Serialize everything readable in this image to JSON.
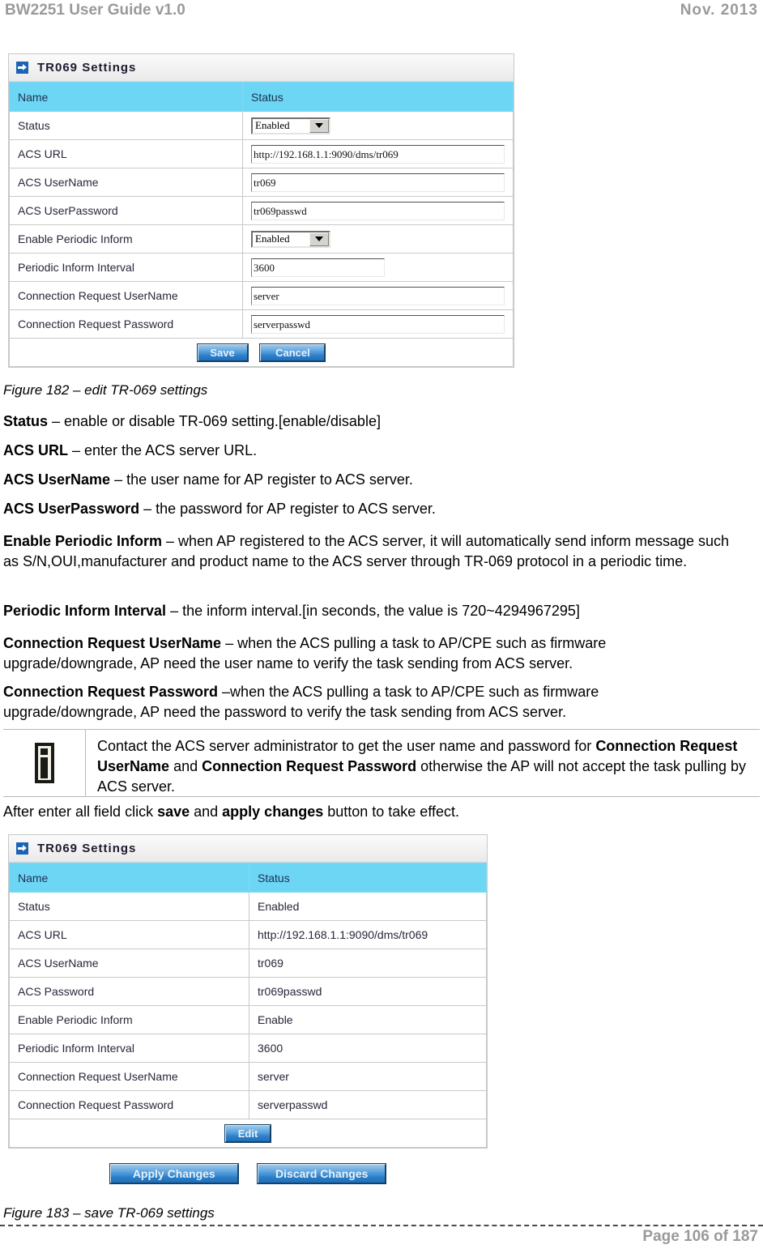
{
  "header": {
    "title": "BW2251 User Guide v1.0",
    "date": "Nov.  2013"
  },
  "figure_182": {
    "panel_title": "TR069 Settings",
    "columns": [
      "Name",
      "Status"
    ],
    "rows": [
      {
        "name": "Status",
        "control": "select",
        "value": "Enabled"
      },
      {
        "name": "ACS URL",
        "control": "text",
        "value": "http://192.168.1.1:9090/dms/tr069"
      },
      {
        "name": "ACS UserName",
        "control": "text",
        "value": "tr069"
      },
      {
        "name": "ACS UserPassword",
        "control": "text",
        "value": "tr069passwd"
      },
      {
        "name": "Enable Periodic Inform",
        "control": "select",
        "value": "Enabled"
      },
      {
        "name": "Periodic Inform Interval",
        "control": "text",
        "value": "3600"
      },
      {
        "name": "Connection Request UserName",
        "control": "text",
        "value": "server"
      },
      {
        "name": "Connection Request Password",
        "control": "text",
        "value": "serverpasswd"
      }
    ],
    "buttons": {
      "save": "Save",
      "cancel": "Cancel"
    },
    "caption": "Figure 182 – edit TR-069 settings"
  },
  "descriptions": [
    {
      "term": "Status",
      "text": " – enable or disable TR-069 setting.[enable/disable]"
    },
    {
      "term": "ACS URL",
      "text": " – enter the ACS server URL."
    },
    {
      "term": "ACS UserName",
      "text": " – the user name for AP register to ACS server."
    },
    {
      "term": "ACS UserPassword",
      "text": " – the password for AP register to ACS server."
    },
    {
      "term": "Enable Periodic Inform",
      "text": " – when AP registered to the ACS server, it will automatically send inform message such as S/N,OUI,manufacturer and product name to the ACS server through TR-069 protocol in a periodic time."
    },
    {
      "term": "Periodic Inform Interval",
      "text": " – the inform interval.[in seconds, the value is 720~4294967295]"
    },
    {
      "term": "Connection Request UserName",
      "text": " – when the ACS pulling a task to AP/CPE such as firmware upgrade/downgrade, AP need the user name to verify the task sending from ACS server."
    },
    {
      "term": "Connection Request Password",
      "text": " –when the ACS pulling a task to AP/CPE such as firmware upgrade/downgrade, AP need the password to verify the task sending from ACS server."
    }
  ],
  "note": {
    "icon": "info-icon",
    "part1": "Contact the ACS server administrator to get the user name and password for ",
    "bold1": "Connection Request UserName",
    "part2": " and ",
    "bold2": "Connection Request Password",
    "part3": " otherwise the AP will not accept the task pulling by ACS server."
  },
  "after_note": {
    "part1": "After enter all field click ",
    "bold1": "save",
    "part2": " and ",
    "bold2": "apply changes",
    "part3": " button to take effect."
  },
  "figure_183": {
    "panel_title": "TR069 Settings",
    "columns": [
      "Name",
      "Status"
    ],
    "rows": [
      {
        "name": "Status",
        "value": "Enabled"
      },
      {
        "name": "ACS URL",
        "value": "http://192.168.1.1:9090/dms/tr069"
      },
      {
        "name": "ACS UserName",
        "value": "tr069"
      },
      {
        "name": "ACS Password",
        "value": "tr069passwd"
      },
      {
        "name": "Enable Periodic Inform",
        "value": "Enable"
      },
      {
        "name": "Periodic Inform Interval",
        "value": "3600"
      },
      {
        "name": "Connection Request UserName",
        "value": "server"
      },
      {
        "name": "Connection Request Password",
        "value": "serverpasswd"
      }
    ],
    "edit_button": "Edit",
    "apply_button": "Apply Changes",
    "discard_button": "Discard Changes",
    "caption": "Figure 183 – save TR-069 settings"
  },
  "footer": {
    "page": "Page 106 of 187"
  },
  "colors": {
    "table_header": "#6ed6f5",
    "panel_icon": "#1c63b5",
    "button_blue": "#2a7fc9",
    "muted_gray": "#9a9a9a"
  }
}
